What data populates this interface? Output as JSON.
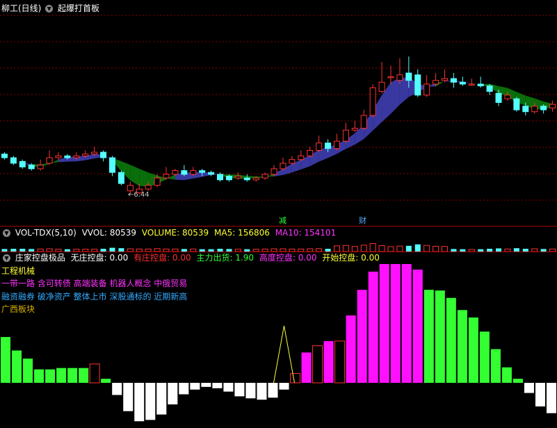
{
  "price_panel": {
    "title": "柳工(日线)",
    "indicator": "起爆打首板",
    "low_label": "←6.44",
    "marker_jian": "减",
    "marker_cai": "财",
    "candles": [
      [
        4.2,
        4.0,
        4.3,
        3.9
      ],
      [
        4.0,
        3.7,
        4.1,
        3.6
      ],
      [
        3.8,
        3.5,
        3.9,
        3.4
      ],
      [
        3.6,
        3.4,
        3.7,
        3.3
      ],
      [
        3.4,
        3.6,
        3.9,
        3.3
      ],
      [
        3.7,
        4.0,
        4.4,
        3.6
      ],
      [
        4.0,
        4.1,
        4.3,
        3.9
      ],
      [
        4.1,
        4.0,
        4.2,
        3.9
      ],
      [
        4.0,
        4.1,
        4.3,
        3.9
      ],
      [
        4.1,
        4.2,
        4.4,
        4.0
      ],
      [
        4.2,
        4.3,
        4.6,
        4.1
      ],
      [
        4.3,
        4.0,
        4.4,
        3.8
      ],
      [
        4.0,
        3.2,
        4.1,
        3.0
      ],
      [
        3.2,
        2.6,
        3.3,
        2.5
      ],
      [
        2.2,
        2.5,
        2.7,
        2.0
      ],
      [
        2.1,
        2.3,
        2.6,
        2.0
      ],
      [
        2.3,
        2.5,
        2.7,
        2.2
      ],
      [
        2.5,
        2.9,
        3.1,
        2.4
      ],
      [
        2.9,
        3.1,
        3.5,
        2.8
      ],
      [
        3.1,
        3.3,
        3.4,
        3.0
      ],
      [
        3.3,
        3.1,
        3.6,
        3.0
      ],
      [
        3.1,
        3.3,
        3.5,
        3.0
      ],
      [
        3.3,
        3.2,
        3.4,
        3.0
      ],
      [
        3.2,
        3.1,
        3.3,
        3.0
      ],
      [
        3.1,
        2.8,
        3.2,
        2.7
      ],
      [
        3.0,
        2.8,
        3.1,
        2.7
      ],
      [
        2.9,
        3.0,
        3.2,
        2.8
      ],
      [
        2.9,
        2.8,
        3.1,
        2.7
      ],
      [
        2.8,
        2.9,
        3.0,
        2.7
      ],
      [
        2.9,
        3.1,
        3.2,
        2.8
      ],
      [
        3.1,
        3.4,
        3.6,
        3.0
      ],
      [
        3.4,
        3.7,
        4.0,
        3.3
      ],
      [
        3.7,
        3.9,
        4.1,
        3.6
      ],
      [
        3.9,
        4.1,
        4.4,
        3.8
      ],
      [
        4.1,
        4.4,
        4.6,
        4.0
      ],
      [
        4.4,
        4.8,
        5.2,
        4.3
      ],
      [
        4.8,
        4.5,
        5.0,
        4.3
      ],
      [
        4.5,
        4.9,
        5.3,
        4.4
      ],
      [
        4.9,
        5.5,
        5.9,
        4.8
      ],
      [
        5.5,
        5.6,
        6.0,
        5.4
      ],
      [
        5.6,
        6.3,
        6.6,
        5.5
      ],
      [
        6.3,
        7.8,
        8.0,
        6.2
      ],
      [
        7.6,
        8.1,
        9.2,
        7.5
      ],
      [
        8.4,
        8.4,
        9.0,
        8.0
      ],
      [
        8.2,
        8.5,
        9.4,
        8.0
      ],
      [
        8.6,
        8.2,
        9.5,
        7.8
      ],
      [
        8.5,
        7.4,
        8.8,
        7.3
      ],
      [
        7.4,
        8.0,
        8.5,
        7.3
      ],
      [
        8.0,
        8.2,
        8.6,
        7.9
      ],
      [
        8.2,
        8.3,
        8.8,
        8.1
      ],
      [
        8.3,
        8.1,
        8.6,
        7.8
      ],
      [
        8.1,
        8.0,
        8.4,
        7.9
      ],
      [
        8.0,
        8.0,
        8.3,
        7.9
      ],
      [
        8.0,
        7.9,
        8.4,
        7.8
      ],
      [
        7.9,
        7.6,
        8.0,
        7.4
      ],
      [
        7.5,
        7.0,
        7.7,
        6.8
      ],
      [
        7.2,
        7.4,
        7.6,
        7.1
      ],
      [
        7.2,
        6.6,
        7.3,
        6.5
      ],
      [
        6.8,
        6.5,
        7.0,
        6.3
      ],
      [
        6.5,
        6.8,
        7.0,
        6.4
      ],
      [
        6.8,
        6.6,
        6.9,
        6.4
      ],
      [
        6.7,
        6.9,
        7.1,
        6.5
      ]
    ]
  },
  "volume_panel": {
    "name": "VOL-TDX(5,10)",
    "vvol": "VVOL: 80539",
    "volume": "VOLUME: 80539",
    "ma5": "MA5: 156806",
    "ma10": "MA10: 154101"
  },
  "indicator_panel": {
    "name": "庄家控盘极品",
    "items": [
      {
        "label": "无庄控盘: 0.00",
        "color": "#ffffff"
      },
      {
        "label": "有庄控盘: 0.00",
        "color": "#ff3030"
      },
      {
        "label": "主力出货: 1.90",
        "color": "#33ff33"
      },
      {
        "label": "高度控盘: 0.00",
        "color": "#ff33ff"
      },
      {
        "label": "开始控盘: 0.00",
        "color": "#ffff33"
      }
    ],
    "industry": "工程机械",
    "concepts_1": "一带一路 含可转债 高端装备 机器人概念 中俄贸易",
    "concepts_2": "融资融券 破净资产 整体上市 深股通标的 近期新高",
    "region": "广西板块",
    "bars": [
      {
        "v": 0.68,
        "c": "g"
      },
      {
        "v": 0.48,
        "c": "g"
      },
      {
        "v": 0.36,
        "c": "g"
      },
      {
        "v": 0.2,
        "c": "g"
      },
      {
        "v": 0.2,
        "c": "g"
      },
      {
        "v": 0.22,
        "c": "g"
      },
      {
        "v": 0.22,
        "c": "g"
      },
      {
        "v": 0.22,
        "c": "g"
      },
      {
        "v": 0.28,
        "c": "ro"
      },
      {
        "v": 0.06,
        "c": "g"
      },
      {
        "v": -0.18,
        "c": "w"
      },
      {
        "v": -0.42,
        "c": "w"
      },
      {
        "v": -0.57,
        "c": "w"
      },
      {
        "v": -0.55,
        "c": "w"
      },
      {
        "v": -0.47,
        "c": "w"
      },
      {
        "v": -0.32,
        "c": "w"
      },
      {
        "v": -0.17,
        "c": "w"
      },
      {
        "v": -0.1,
        "c": "w"
      },
      {
        "v": -0.06,
        "c": "w"
      },
      {
        "v": -0.08,
        "c": "w"
      },
      {
        "v": -0.13,
        "c": "w"
      },
      {
        "v": -0.2,
        "c": "w"
      },
      {
        "v": -0.23,
        "c": "w"
      },
      {
        "v": -0.25,
        "c": "w"
      },
      {
        "v": -0.22,
        "c": "w"
      },
      {
        "v": -0.1,
        "c": "w"
      },
      {
        "v": 0.14,
        "c": "ro"
      },
      {
        "v": 0.45,
        "c": "m"
      },
      {
        "v": 0.55,
        "c": "ro"
      },
      {
        "v": 0.62,
        "c": "m"
      },
      {
        "v": 0.62,
        "c": "ro"
      },
      {
        "v": 1.0,
        "c": "m"
      },
      {
        "v": 1.38,
        "c": "m"
      },
      {
        "v": 1.65,
        "c": "m"
      },
      {
        "v": 1.78,
        "c": "m"
      },
      {
        "v": 1.78,
        "c": "m"
      },
      {
        "v": 1.78,
        "c": "m"
      },
      {
        "v": 1.68,
        "c": "m"
      },
      {
        "v": 1.38,
        "c": "g"
      },
      {
        "v": 1.37,
        "c": "g"
      },
      {
        "v": 1.26,
        "c": "g"
      },
      {
        "v": 1.08,
        "c": "g"
      },
      {
        "v": 0.97,
        "c": "g"
      },
      {
        "v": 0.76,
        "c": "g"
      },
      {
        "v": 0.5,
        "c": "g"
      },
      {
        "v": 0.23,
        "c": "g"
      },
      {
        "v": 0.06,
        "c": "g"
      },
      {
        "v": -0.15,
        "c": "w"
      },
      {
        "v": -0.35,
        "c": "w"
      },
      {
        "v": -0.45,
        "c": "w"
      }
    ]
  },
  "colors": {
    "up": "#ff3232",
    "down": "#54ffff",
    "ribbon_green": "#0a6e0a",
    "ribbon_blue": "#3838a0",
    "grid": "#8a0000"
  }
}
